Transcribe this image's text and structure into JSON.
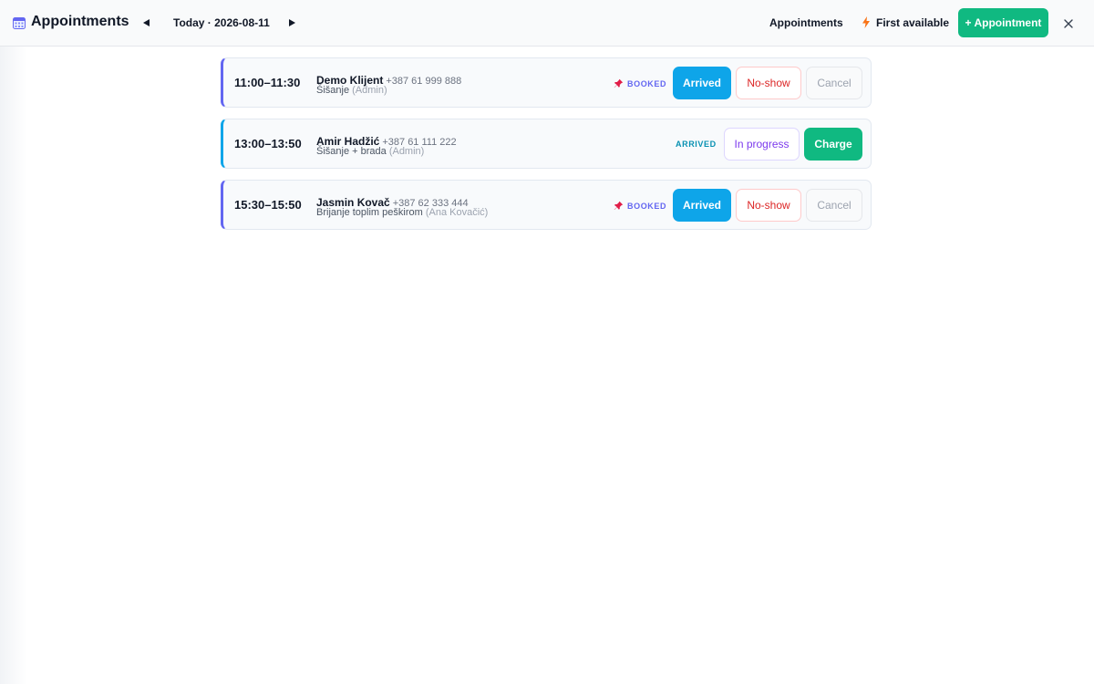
{
  "header": {
    "title": "Appointments",
    "app_icon": "calendar-icon",
    "date_label": "Today · 2026-08-11",
    "prev_icon": "triangle-left-icon",
    "next_icon": "triangle-right-icon",
    "appointments_link": "Appointments",
    "first_available": "First available",
    "add_button": "+ Appointment",
    "close_icon": "close-icon"
  },
  "colors": {
    "primary_green": "#10b981",
    "arrived_blue": "#0ea5e9",
    "booked_indigo": "#6366f1",
    "noshow_red": "#dc2626",
    "progress_purple": "#7c3aed"
  },
  "appointments": [
    {
      "time": "11:00–11:30",
      "client": "Demo Klijent",
      "phone": "+387 61 999 888",
      "service": "Šišanje",
      "staff": "(Admin)",
      "status": "BOOKED",
      "actions": [
        "Arrived",
        "No-show",
        "Cancel"
      ]
    },
    {
      "time": "13:00–13:50",
      "client": "Amir Hadžić",
      "phone": "+387 61 111 222",
      "service": "Šišanje + brada",
      "staff": "(Admin)",
      "status": "ARRIVED",
      "actions": [
        "In progress",
        "Charge"
      ]
    },
    {
      "time": "15:30–15:50",
      "client": "Jasmin Kovač",
      "phone": "+387 62 333 444",
      "service": "Brijanje toplim peškirom",
      "staff": "(Ana Kovačić)",
      "status": "BOOKED",
      "actions": [
        "Arrived",
        "No-show",
        "Cancel"
      ]
    }
  ]
}
